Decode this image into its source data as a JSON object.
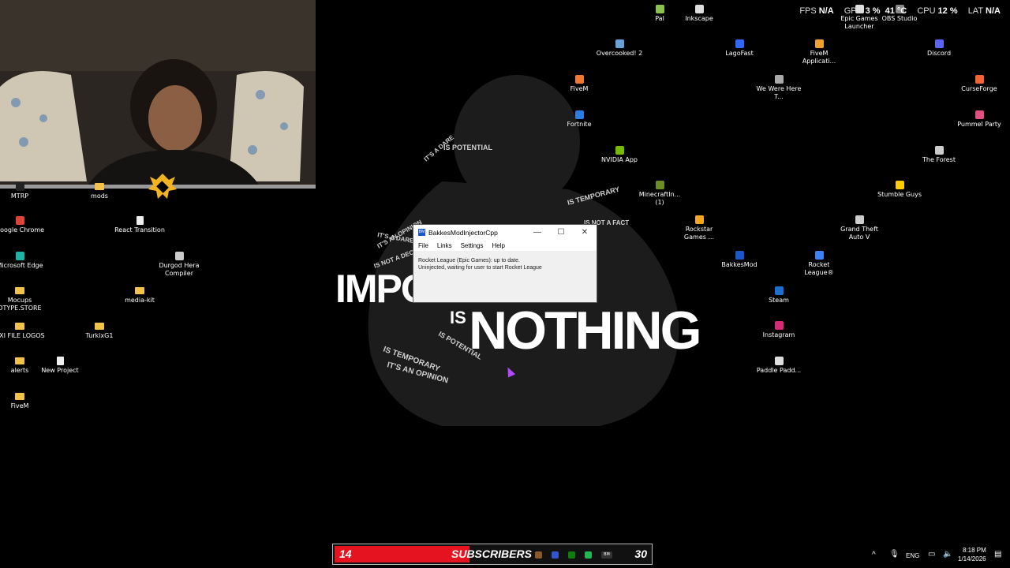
{
  "wallpaper": {
    "headline_left": "IMPO",
    "headline_small": "IS",
    "headline_right": "NOTHING",
    "words": [
      "IS POTENTIAL",
      "IT'S A DARE",
      "IS TEMPORARY",
      "IS NOT A FACT",
      "IT'S AN OPINION",
      "IS NOT A DECLARATION",
      "IT'S A DARE",
      "IS POTENTIAL",
      "IS TEMPORARY",
      "IT'S AN OPINION"
    ]
  },
  "webcam": {
    "visible": true
  },
  "overlay": {
    "fps_label": "FPS",
    "fps_value": "N/A",
    "gpu_label": "GPU",
    "gpu_value": "3 %",
    "gpu_temp": "41 °C",
    "cpu_label": "CPU",
    "cpu_value": "12 %",
    "lat_label": "LAT",
    "lat_value": "N/A"
  },
  "desktop_left": [
    {
      "label": "MTRP",
      "icon": "app-icon",
      "color": "#222222"
    },
    {
      "label": "mods",
      "icon": "folder-icon",
      "color": "#f2c24a"
    },
    {
      "label": "Google Chrome",
      "icon": "chrome-icon",
      "color": "#db4437"
    },
    {
      "label": "React Transition",
      "icon": "file-icon",
      "color": "#eeeeee"
    },
    {
      "label": "Durgod Hera Compiler",
      "icon": "app-icon",
      "color": "#cccccc"
    },
    {
      "label": "Microsoft Edge",
      "icon": "edge-icon",
      "color": "#1fb3a6"
    },
    {
      "label": "Mocups DTYPE.STORE",
      "icon": "folder-icon",
      "color": "#f2c24a"
    },
    {
      "label": "media-kit",
      "icon": "folder-icon",
      "color": "#f2c24a"
    },
    {
      "label": "OXI FILE LOGOS",
      "icon": "folder-icon",
      "color": "#f2c24a"
    },
    {
      "label": "TurkixG1",
      "icon": "folder-icon",
      "color": "#f2c24a"
    },
    {
      "label": "alerts",
      "icon": "folder-icon",
      "color": "#f2c24a"
    },
    {
      "label": "New Project",
      "icon": "file-icon",
      "color": "#eeeeee"
    },
    {
      "label": "FiveM",
      "icon": "folder-icon",
      "color": "#f2c24a"
    }
  ],
  "desktop_right": [
    {
      "label": "Pal",
      "icon": "app-icon",
      "color": "#8bc34a"
    },
    {
      "label": "Inkscape",
      "icon": "inkscape-icon",
      "color": "#dddddd"
    },
    {
      "label": "Epic Games Launcher",
      "icon": "epic-icon",
      "color": "#dddddd"
    },
    {
      "label": "OBS Studio",
      "icon": "obs-icon",
      "color": "#888888"
    },
    {
      "label": "Overcooked! 2",
      "icon": "game-icon",
      "color": "#6aa0d8"
    },
    {
      "label": "LagoFast",
      "icon": "app-icon",
      "color": "#3366ff"
    },
    {
      "label": "FiveM Applicati...",
      "icon": "fivem-icon",
      "color": "#f0a030"
    },
    {
      "label": "Discord",
      "icon": "discord-icon",
      "color": "#5865f2"
    },
    {
      "label": "FiveM",
      "icon": "fivem-icon",
      "color": "#f07830"
    },
    {
      "label": "We Were Here T...",
      "icon": "game-icon",
      "color": "#aaaaaa"
    },
    {
      "label": "CurseForge",
      "icon": "curseforge-icon",
      "color": "#f16436"
    },
    {
      "label": "Fortnite",
      "icon": "fortnite-icon",
      "color": "#2a7de1"
    },
    {
      "label": "Pummel Party",
      "icon": "game-icon",
      "color": "#e05080"
    },
    {
      "label": "NVIDIA App",
      "icon": "nvidia-icon",
      "color": "#76b900"
    },
    {
      "label": "The Forest",
      "icon": "game-icon",
      "color": "#cccccc"
    },
    {
      "label": "MinecraftIn... (1)",
      "icon": "minecraft-icon",
      "color": "#6b8e23"
    },
    {
      "label": "Stumble Guys",
      "icon": "game-icon",
      "color": "#ffcc00"
    },
    {
      "label": "Rockstar Games ...",
      "icon": "rockstar-icon",
      "color": "#f5a623"
    },
    {
      "label": "Grand Theft Auto V",
      "icon": "gta-icon",
      "color": "#cccccc"
    },
    {
      "label": "BakkesMod",
      "icon": "bakkesmod-icon",
      "color": "#1a56c8"
    },
    {
      "label": "Rocket League®",
      "icon": "rocket-league-icon",
      "color": "#3b82f6"
    },
    {
      "label": "Steam",
      "icon": "steam-icon",
      "color": "#1b6fd1"
    },
    {
      "label": "Instagram",
      "icon": "instagram-icon",
      "color": "#d62976"
    },
    {
      "label": "Paddle Padd...",
      "icon": "game-icon",
      "color": "#dddddd"
    }
  ],
  "window": {
    "title": "BakkesModInjectorCpp",
    "app_icon_text": "BM",
    "menu": [
      "File",
      "Links",
      "Settings",
      "Help"
    ],
    "line1": "Rocket League (Epic Games): up to date.",
    "line2": "Uninjected, waiting for user to start Rocket League",
    "minimize": "—",
    "maximize": "☐",
    "close": "✕"
  },
  "subscriber_bar": {
    "current": "14",
    "label": "SUBSCRIBERS",
    "goal": "30",
    "progress": 0.467,
    "fill_color": "#e4131f"
  },
  "taskbar_apps": [
    {
      "name": "overcooked-taskbar-icon",
      "color": "#8b5a2b"
    },
    {
      "name": "app-taskbar-icon",
      "color": "#3355cc"
    },
    {
      "name": "xbox-taskbar-icon",
      "color": "#107c10"
    },
    {
      "name": "spotify-taskbar-icon",
      "color": "#1db954"
    },
    {
      "name": "bakkesmod-taskbar-icon",
      "color": "#333333",
      "text": "BM"
    }
  ],
  "tray": {
    "chevron": "^",
    "language": "ENG",
    "time": "8:18 PM",
    "date": "1/14/2026"
  }
}
